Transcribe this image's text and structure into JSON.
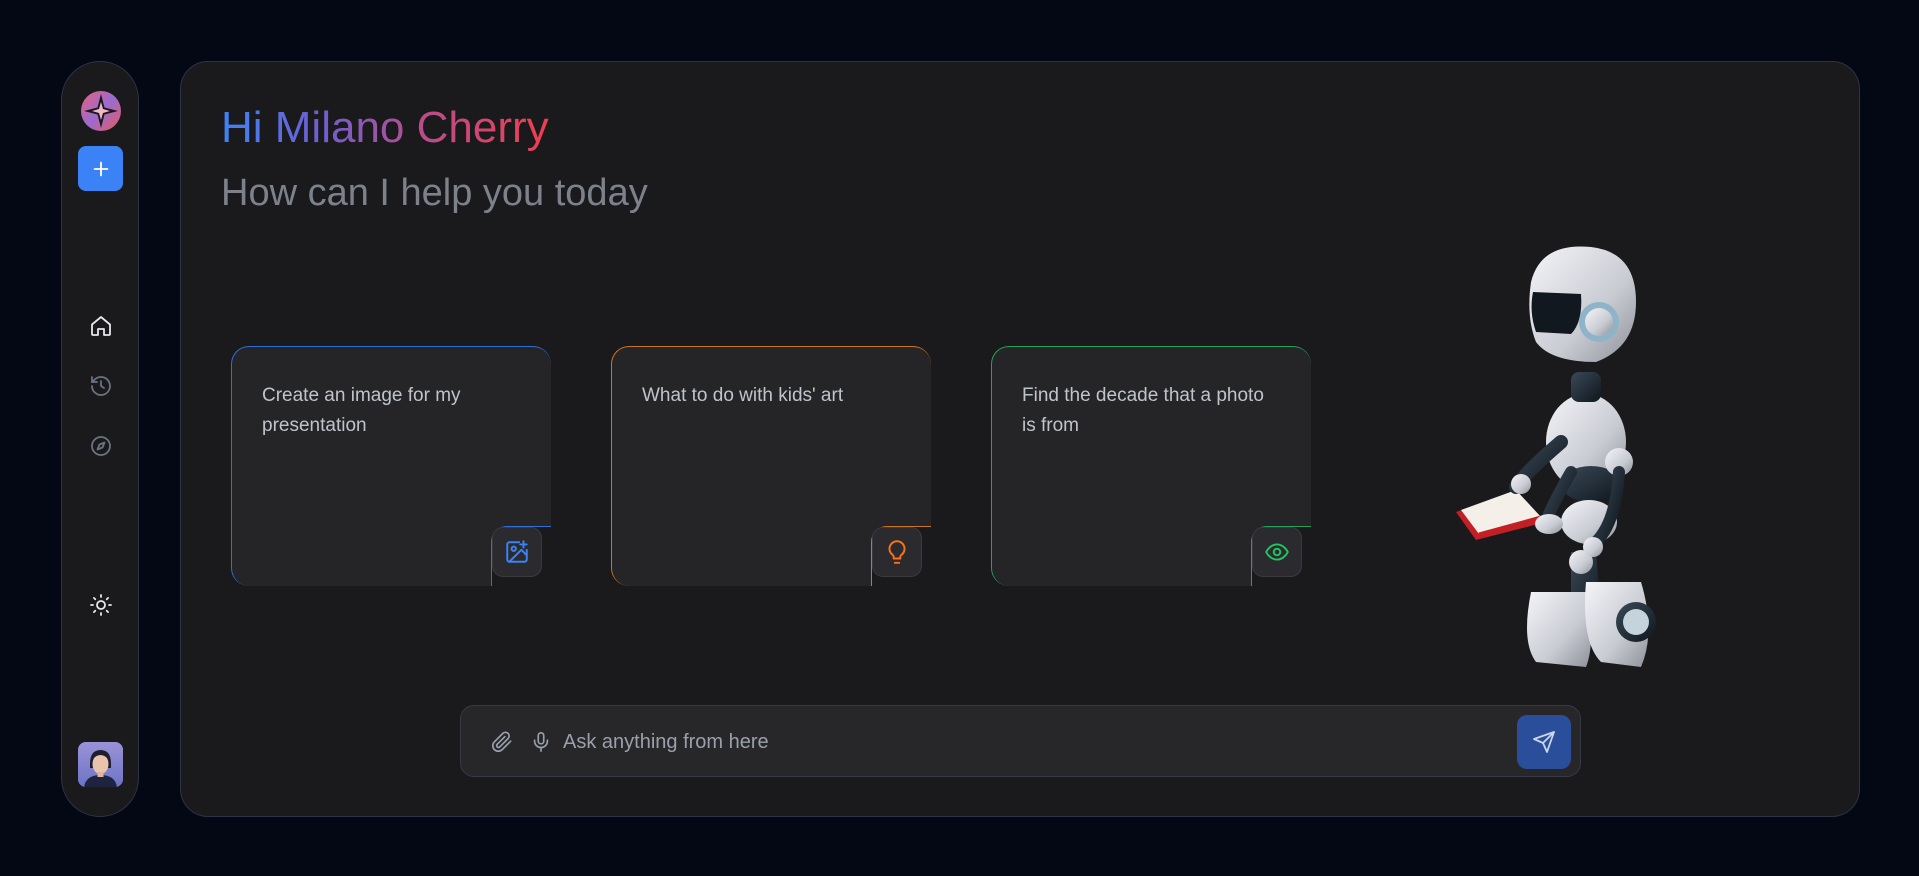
{
  "sidebar": {
    "logo_icon": "ai-star-logo",
    "new_chat_icon": "plus-icon",
    "nav": [
      {
        "icon": "home-icon",
        "active": true
      },
      {
        "icon": "history-icon",
        "active": false
      },
      {
        "icon": "compass-icon",
        "active": false
      }
    ],
    "theme_icon": "sun-icon",
    "avatar": "user-avatar"
  },
  "header": {
    "greeting": "Hi Milano Cherry",
    "subtitle": "How can I help you today"
  },
  "cards": [
    {
      "text": "Create an image for my presentation",
      "icon": "image-plus-icon",
      "color": "#3b82f6"
    },
    {
      "text": "What to do with kids' art",
      "icon": "lightbulb-icon",
      "color": "#f97316"
    },
    {
      "text": "Find the decade that a photo is from",
      "icon": "eye-icon",
      "color": "#22c55e"
    }
  ],
  "chat": {
    "placeholder": "Ask anything from here",
    "attach_icon": "paperclip-icon",
    "mic_icon": "microphone-icon",
    "send_icon": "send-icon"
  },
  "colors": {
    "accent": "#3b82f6",
    "gradient": [
      "#3d84f6",
      "#ef3e4e"
    ]
  }
}
